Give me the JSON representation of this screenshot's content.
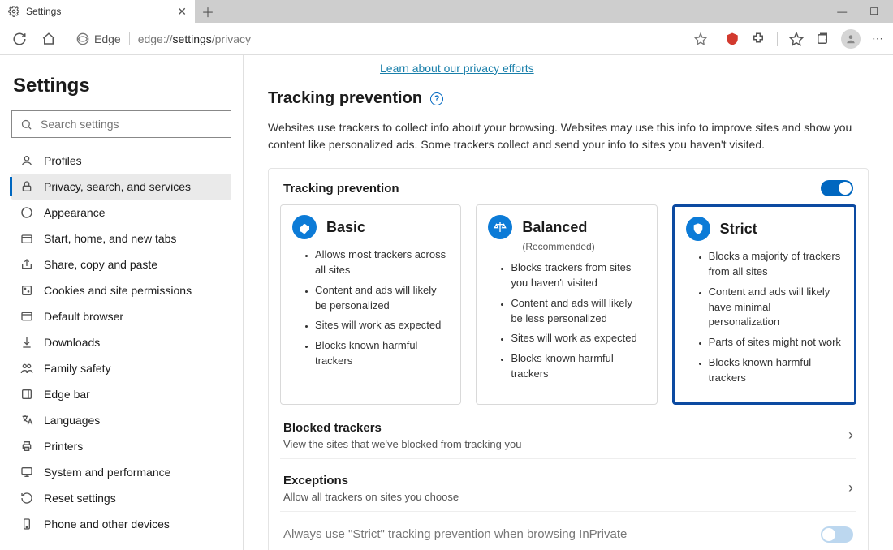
{
  "tab": {
    "title": "Settings"
  },
  "address": {
    "engine": "Edge",
    "url_prefix": "edge://",
    "url_bold": "settings",
    "url_suffix": "/privacy"
  },
  "sidebar": {
    "heading": "Settings",
    "search_placeholder": "Search settings",
    "items": [
      "Profiles",
      "Privacy, search, and services",
      "Appearance",
      "Start, home, and new tabs",
      "Share, copy and paste",
      "Cookies and site permissions",
      "Default browser",
      "Downloads",
      "Family safety",
      "Edge bar",
      "Languages",
      "Printers",
      "System and performance",
      "Reset settings",
      "Phone and other devices"
    ]
  },
  "main": {
    "cutoff_link": "Learn about our privacy efforts",
    "section_title": "Tracking prevention",
    "section_desc": "Websites use trackers to collect info about your browsing. Websites may use this info to improve sites and show you content like personalized ads. Some trackers collect and send your info to sites you haven't visited.",
    "panel_head": "Tracking prevention",
    "cards": {
      "basic": {
        "title": "Basic",
        "bullets": [
          "Allows most trackers across all sites",
          "Content and ads will likely be personalized",
          "Sites will work as expected",
          "Blocks known harmful trackers"
        ]
      },
      "balanced": {
        "title": "Balanced",
        "sub": "(Recommended)",
        "bullets": [
          "Blocks trackers from sites you haven't visited",
          "Content and ads will likely be less personalized",
          "Sites will work as expected",
          "Blocks known harmful trackers"
        ]
      },
      "strict": {
        "title": "Strict",
        "bullets": [
          "Blocks a majority of trackers from all sites",
          "Content and ads will likely have minimal personalization",
          "Parts of sites might not work",
          "Blocks known harmful trackers"
        ]
      }
    },
    "blocked": {
      "title": "Blocked trackers",
      "sub": "View the sites that we've blocked from tracking you"
    },
    "exceptions": {
      "title": "Exceptions",
      "sub": "Allow all trackers on sites you choose"
    },
    "inprivate": {
      "title": "Always use \"Strict\" tracking prevention when browsing InPrivate"
    }
  }
}
